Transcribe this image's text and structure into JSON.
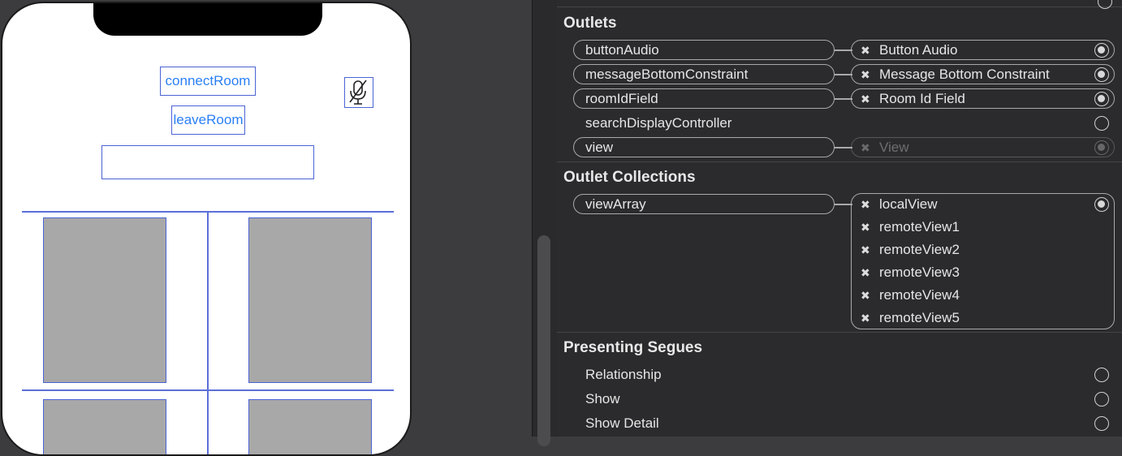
{
  "canvas": {
    "buttons": {
      "connect": "connectRoom",
      "leave": "leaveRoom"
    },
    "room_id_input": {
      "value": "",
      "placeholder": ""
    },
    "mute_icon": "mic-slash-icon"
  },
  "inspector": {
    "outlets": {
      "title": "Outlets",
      "rows": [
        {
          "name": "buttonAudio",
          "target": "Button Audio",
          "connected": true
        },
        {
          "name": "messageBottomConstraint",
          "target": "Message Bottom Constraint",
          "connected": true
        },
        {
          "name": "roomIdField",
          "target": "Room Id Field",
          "connected": true
        },
        {
          "name": "searchDisplayController",
          "target": "",
          "connected": false
        },
        {
          "name": "view",
          "target": "View",
          "connected": true,
          "dimmed": true
        }
      ]
    },
    "outlet_collections": {
      "title": "Outlet Collections",
      "name": "viewArray",
      "targets": [
        "localView",
        "remoteView1",
        "remoteView2",
        "remoteView3",
        "remoteView4",
        "remoteView5"
      ]
    },
    "presenting_segues": {
      "title": "Presenting Segues",
      "rows": [
        "Relationship",
        "Show",
        "Show Detail"
      ]
    }
  },
  "colors": {
    "accent": "#2a7ff5",
    "selection": "#4a63d6",
    "panel_bg": "#2b2b2d"
  }
}
